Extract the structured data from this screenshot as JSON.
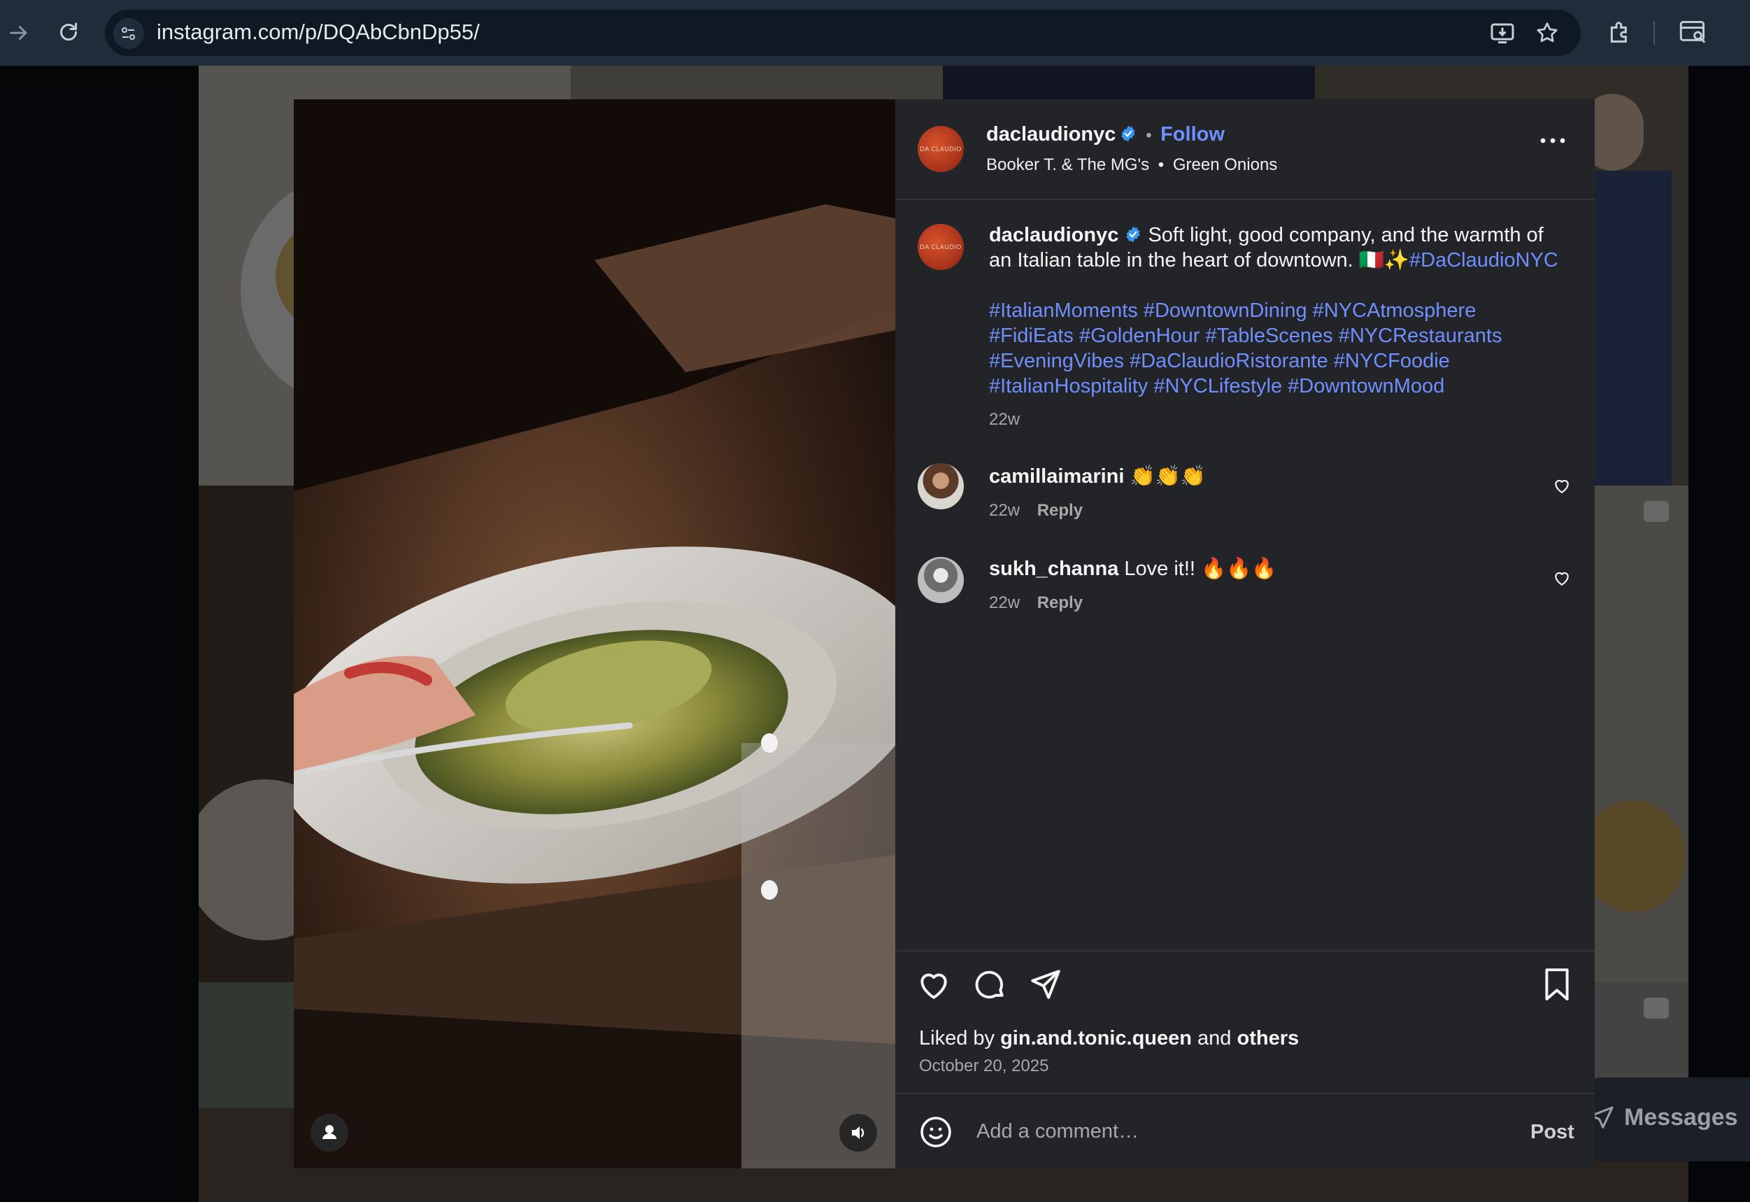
{
  "browser": {
    "url": "instagram.com/p/DQAbCbnDp55/"
  },
  "post": {
    "author": "daclaudionyc",
    "follow_label": "Follow",
    "separator": "•",
    "audio_artist": "Booker T. & The MG's",
    "audio_track": "Green Onions",
    "avatar_text": "DA CLAUDIO",
    "caption_author": "daclaudionyc",
    "caption_text": "Soft light, good company, and the warmth of an Italian table in the heart of downtown. 🇮🇹✨",
    "caption_tag": "#DaClaudioNYC",
    "hashtag_lines": [
      "#ItalianMoments #DowntownDining #NYCAtmosphere",
      "#FidiEats #GoldenHour #TableScenes #NYCRestaurants",
      "#EveningVibes #DaClaudioRistorante #NYCFoodie",
      "#ItalianHospitality #NYCLifestyle #DowntownMood"
    ],
    "caption_age": "22w",
    "comments": [
      {
        "user": "camillaimarini",
        "text": "👏👏👏",
        "age": "22w",
        "reply": "Reply"
      },
      {
        "user": "sukh_channa",
        "text": "Love it!! 🔥🔥🔥",
        "age": "22w",
        "reply": "Reply"
      }
    ],
    "liked_prefix": "Liked by",
    "liked_user": "gin.and.tonic.queen",
    "liked_and": "and",
    "liked_others": "others",
    "date": "October 20, 2025",
    "comment_placeholder": "Add a comment…",
    "post_button": "Post"
  },
  "messages_label": "Messages",
  "colors": {
    "accent_link": "#6f8fff",
    "verified": "#3797f0",
    "panel_bg": "#232428"
  }
}
